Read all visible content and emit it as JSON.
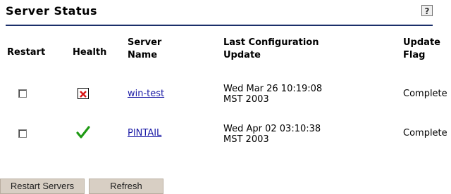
{
  "header": {
    "title": "Server Status",
    "help_label": "?"
  },
  "table": {
    "columns": [
      "Restart",
      "Health",
      "Server Name",
      "Last Configuration Update",
      "Update Flag"
    ],
    "rows": [
      {
        "restart_checked": false,
        "health": "error",
        "server": "win-test",
        "last_update_line1": "Wed Mar 26 10:19:08",
        "last_update_line2": "MST 2003",
        "flag": "Complete"
      },
      {
        "restart_checked": false,
        "health": "ok",
        "server": "PINTAIL",
        "last_update_line1": "Wed Apr 02 03:10:38",
        "last_update_line2": "MST 2003",
        "flag": "Complete"
      }
    ]
  },
  "buttons": {
    "restart_label": "Restart Servers",
    "refresh_label": "Refresh"
  },
  "colors": {
    "error_red": "#d81414",
    "ok_green": "#1f9a14",
    "link_blue": "#1a1aa6",
    "rule_navy": "#1b2f6a"
  }
}
